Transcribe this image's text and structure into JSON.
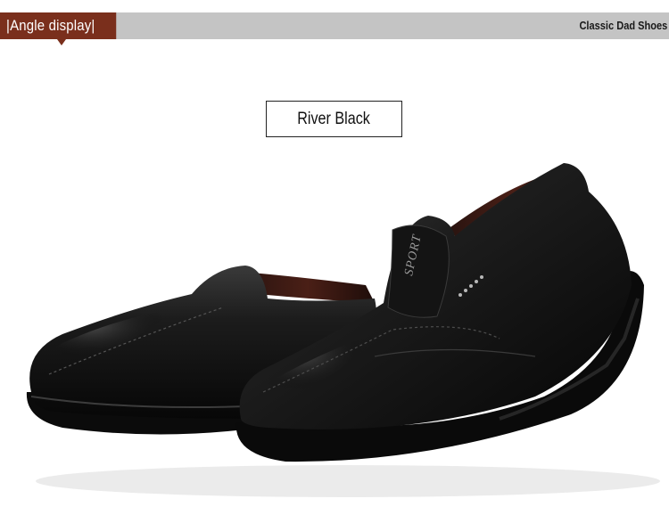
{
  "banner": {
    "tag_label": "|Angle display|",
    "right_label": "Classic Dad Shoes",
    "tag_color": "#7a2f1c",
    "bar_color": "#c4c4c4"
  },
  "product": {
    "color_name": "River Black",
    "emboss_text": "SPORT"
  }
}
